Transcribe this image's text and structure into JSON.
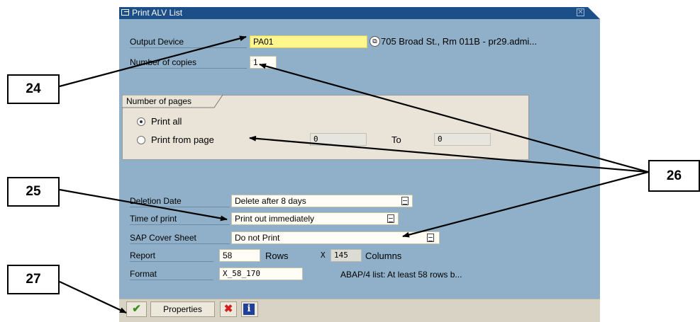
{
  "dialog": {
    "title": "Print ALV List",
    "output_device_label": "Output Device",
    "output_device_value": "PA01",
    "output_device_desc": "705 Broad St., Rm 011B - pr29.admi...",
    "copies_label": "Number of copies",
    "copies_value": "1",
    "pages_group_label": "Number of pages",
    "print_all_label": "Print all",
    "print_from_label": "Print from page",
    "from_value": "0",
    "to_label": "To",
    "to_value": "0",
    "deletion_label": "Deletion Date",
    "deletion_value": "Delete after 8 days",
    "time_label": "Time of print",
    "time_value": "Print out immediately",
    "cover_label": "SAP Cover Sheet",
    "cover_value": "Do not Print",
    "report_label": "Report",
    "rows_value": "58",
    "rows_label": "Rows",
    "x_label": "X",
    "cols_value": "145",
    "cols_label": "Columns",
    "format_label": "Format",
    "format_value": "X_58_170",
    "format_desc": "ABAP/4 list: At least 58 rows b..."
  },
  "toolbar": {
    "properties_label": "Properties"
  },
  "callouts": {
    "c24": "24",
    "c25": "25",
    "c26": "26",
    "c27": "27"
  },
  "colors": {
    "titlebar": "#1c4e87",
    "dialog_bg": "#8fb0c8",
    "highlight_field": "#fff78e"
  },
  "icons": [
    "window-icon",
    "close-icon",
    "lookup-icon",
    "dropdown-icon",
    "check-icon",
    "cancel-icon",
    "info-icon"
  ]
}
